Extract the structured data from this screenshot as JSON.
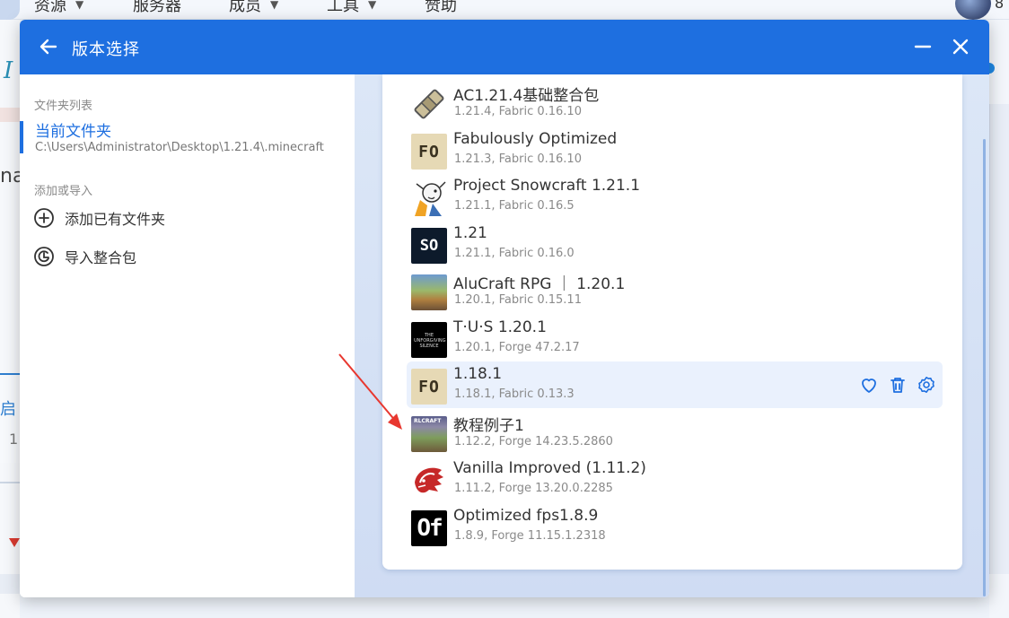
{
  "background": {
    "nav_items": [
      "资源",
      "服务器",
      "成员",
      "工具",
      "赞助"
    ],
    "user_number": "8",
    "left_fragments": [
      "I",
      "na",
      "启",
      "1",
      "启"
    ]
  },
  "dialog": {
    "title": "版本选择",
    "sidebar": {
      "folder_list_label": "文件夹列表",
      "current_folder": {
        "title": "当前文件夹",
        "path": "C:\\Users\\Administrator\\Desktop\\1.21.4\\.minecraft"
      },
      "add_or_import_label": "添加或导入",
      "actions": [
        {
          "label": "添加已有文件夹",
          "icon": "plus-circle-icon"
        },
        {
          "label": "导入整合包",
          "icon": "import-package-icon"
        }
      ]
    },
    "versions": [
      {
        "name": "AC1.21.4基础整合包",
        "meta": "1.21.4, Fabric 0.16.10",
        "thumb": "bandage",
        "thumb_text": ""
      },
      {
        "name": "Fabulously Optimized",
        "meta": "1.21.3, Fabric 0.16.10",
        "thumb": "fo",
        "thumb_text": "FO"
      },
      {
        "name": "Project Snowcraft 1.21.1",
        "meta": "1.21.1, Fabric 0.16.5",
        "thumb": "snowcraft",
        "thumb_text": ""
      },
      {
        "name": "1.21",
        "meta": "1.21.1, Fabric 0.16.0",
        "thumb": "so",
        "thumb_text": "SO"
      },
      {
        "name": "AluCraft RPG ｜ 1.20.1",
        "meta": "1.20.1, Fabric 0.15.11",
        "thumb": "alu",
        "thumb_text": ""
      },
      {
        "name": "T·U·S 1.20.1",
        "meta": "1.20.1, Forge 47.2.17",
        "thumb": "tus",
        "thumb_text": "THE UNFORGIVING SILENCE"
      },
      {
        "name": "1.18.1",
        "meta": "1.18.1, Fabric 0.13.3",
        "thumb": "fo",
        "thumb_text": "FO",
        "hovered": true
      },
      {
        "name": "教程例子1",
        "meta": "1.12.2, Forge 14.23.5.2860",
        "thumb": "tut",
        "thumb_text": "RLCRAFT"
      },
      {
        "name": "Vanilla Improved (1.11.2)",
        "meta": "1.11.2, Forge 13.20.0.2285",
        "thumb": "vanilla",
        "thumb_text": ""
      },
      {
        "name": "Optimized fps1.8.9",
        "meta": "1.8.9, Forge 11.15.1.2318",
        "thumb": "of",
        "thumb_text": "Of"
      }
    ],
    "row_actions": [
      "heart-icon",
      "trash-icon",
      "settings-gear-icon"
    ],
    "colors": {
      "accent": "#1e6fe0",
      "arrow": "#e8372f"
    }
  }
}
